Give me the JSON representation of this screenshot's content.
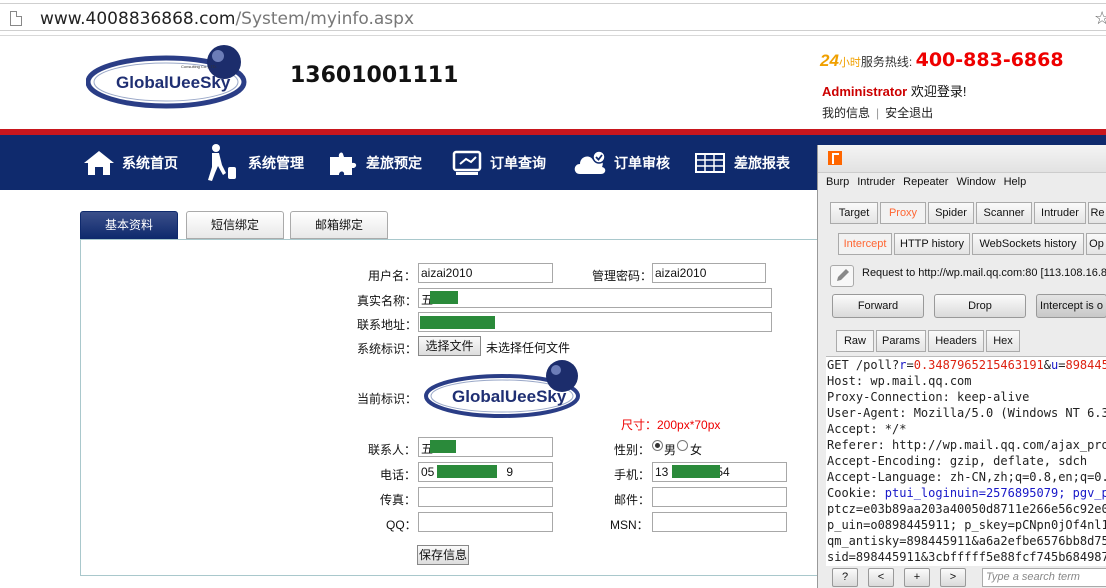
{
  "browser": {
    "url_host": "www.4008836868.com",
    "url_path": "/System/myinfo.aspx"
  },
  "header": {
    "logo_text": "GlobalUeeSky",
    "logo_sub": "Consulting Co.,LTD.",
    "account_phone": "13601001111",
    "hotline_24": "24",
    "hotline_24b": "小时",
    "hotline_label": "服务热线:",
    "hotline_number": "400-883-6868",
    "admin_name": "Administrator",
    "welcome": "欢迎登录!",
    "my_info": "我的信息",
    "separator": "|",
    "logout": "安全退出"
  },
  "nav": {
    "items": [
      {
        "label": "系统首页",
        "icon": "home-icon"
      },
      {
        "label": "系统管理",
        "icon": "traveler-icon"
      },
      {
        "label": "差旅预定",
        "icon": "puzzle-icon"
      },
      {
        "label": "订单查询",
        "icon": "ticket-icon"
      },
      {
        "label": "订单审核",
        "icon": "cloud-check-icon"
      },
      {
        "label": "差旅报表",
        "icon": "table-icon"
      }
    ]
  },
  "tabs": [
    "基本资料",
    "短信绑定",
    "邮箱绑定"
  ],
  "form": {
    "username_label": "用户名：",
    "username": "aizai2010",
    "password_label": "管理密码：",
    "password": "aizai2010",
    "realname_label": "真实名称：",
    "realname": "五",
    "address_label": "联系地址：",
    "sysmark_label": "系统标识：",
    "choose_file": "选择文件",
    "no_file": "未选择任何文件",
    "current_mark_label": "当前标识：",
    "size_hint": "尺寸：200px*70px",
    "contact_label": "联系人：",
    "contact": "五",
    "gender_label": "性别：",
    "male": "男",
    "female": "女",
    "phone_label": "电话：",
    "phone_prefix": "05",
    "phone_suffix": "9",
    "mobile_label": "手机：",
    "mobile_prefix": "13",
    "mobile_suffix": "54",
    "fax_label": "传真：",
    "email_label": "邮件：",
    "qq_label": "QQ：",
    "msn_label": "MSN：",
    "save": "保存信息"
  },
  "burp": {
    "menu": [
      "Burp",
      "Intruder",
      "Repeater",
      "Window",
      "Help"
    ],
    "tabs": [
      "Target",
      "Proxy",
      "Spider",
      "Scanner",
      "Intruder",
      "Re"
    ],
    "subtabs": [
      "Intercept",
      "HTTP history",
      "WebSockets history",
      "Op"
    ],
    "request": "Request to http://wp.mail.qq.com:80  [113.108.16.8",
    "forward": "Forward",
    "drop": "Drop",
    "intercept": "Intercept is o",
    "view_tabs": [
      "Raw",
      "Params",
      "Headers",
      "Hex"
    ],
    "raw": {
      "l1a": "GET /poll?",
      "l1b": "r",
      "l1c": "=",
      "l1d": "0.3487965215463191",
      "l1e": "&",
      "l1f": "u",
      "l1g": "=",
      "l1h": "8984459",
      "l2": "Host: wp.mail.qq.com",
      "l3": "Proxy-Connection: keep-alive",
      "l4": "User-Agent: Mozilla/5.0 (Windows NT 6.3;",
      "l5": "Accept: */*",
      "l6": "Referer: http://wp.mail.qq.com/ajax_prox",
      "l7": "Accept-Encoding: gzip, deflate, sdch",
      "l8": "Accept-Language: zh-CN,zh;q=0.8,en;q=0.6",
      "l9a": "Cookie: ",
      "l9b": "ptui_loginuin=2576895079; pgv_pv",
      "l10": "ptcz=e03b89aa203a40050d8711e266e56c92e02",
      "l11": "p_uin=o0898445911; p_skey=pCNpn0jOf4nl15",
      "l12": "qm_antisky=898445911&a6a2efbe6576bb8d758",
      "l13": "sid=898445911&3cbfffff5e88fcf745b6849876"
    },
    "help_btn": "?",
    "prev_btn": "<",
    "plus_btn": "+",
    "next_btn": ">",
    "search_placeholder": "Type a search term"
  }
}
